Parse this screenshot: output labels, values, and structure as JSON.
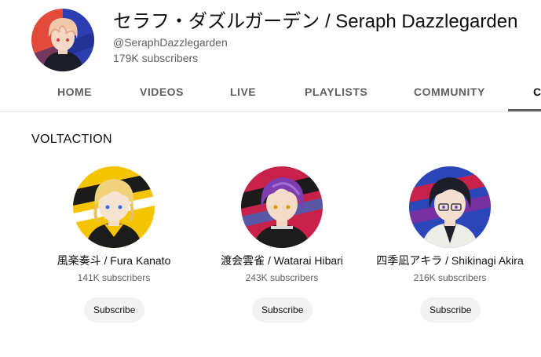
{
  "channel": {
    "title": "セラフ・ダズルガーデン / Seraph Dazzlegarden",
    "handle": "@SeraphDazzlegarden",
    "subscribers": "179K subscribers",
    "avatar_colors": {
      "left": "#e24a3a",
      "right": "#2d3fb0",
      "hair": "#f0c8a8"
    }
  },
  "tabs": [
    {
      "label": "HOME"
    },
    {
      "label": "VIDEOS"
    },
    {
      "label": "LIVE"
    },
    {
      "label": "PLAYLISTS"
    },
    {
      "label": "COMMUNITY"
    },
    {
      "label": "C"
    }
  ],
  "section": {
    "title": "VOLTACTION",
    "channels": [
      {
        "name": "風楽奏斗 / Fura Kanato",
        "subscribers": "141K subscribers",
        "subscribe_label": "Subscribe",
        "avatar_colors": {
          "bg": "#f5c400",
          "hair": "#f0d27a",
          "outfit": "#1c1c1c"
        }
      },
      {
        "name": "渡会雲雀 / Watarai Hibari",
        "subscribers": "243K subscribers",
        "subscribe_label": "Subscribe",
        "avatar_colors": {
          "bg": "#c9224a",
          "hair": "#7e3db0",
          "outfit": "#1c1c1c"
        }
      },
      {
        "name": "四季凪アキラ / Shikinagi Akira",
        "subscribers": "216K subscribers",
        "subscribe_label": "Subscribe",
        "avatar_colors": {
          "bg": "#2b46b8",
          "hair": "#1e1e2a",
          "outfit": "#ecece8"
        }
      }
    ]
  }
}
